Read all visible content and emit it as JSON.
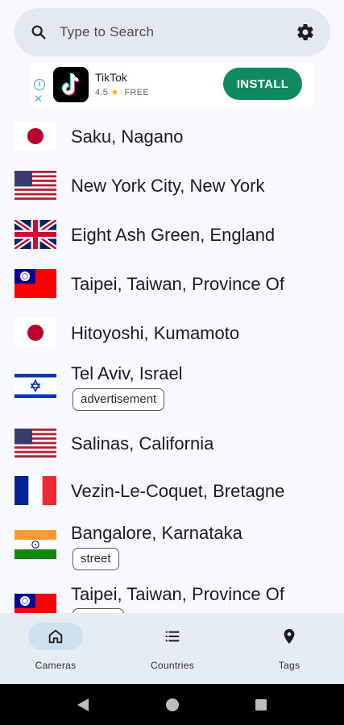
{
  "search": {
    "placeholder": "Type to Search",
    "icon": "search-icon",
    "settings_icon": "gear-icon"
  },
  "ad": {
    "info_icon": "i",
    "close_icon": "✕",
    "app_name": "TikTok",
    "rating": "4.5",
    "star": "★",
    "price": "FREE",
    "install_label": "INSTALL",
    "install_color": "#0f8a5f"
  },
  "cameras": [
    {
      "flag": "japan",
      "name": "Saku, Nagano"
    },
    {
      "flag": "usa",
      "name": "New York City, New York"
    },
    {
      "flag": "uk",
      "name": "Eight Ash Green, England"
    },
    {
      "flag": "taiwan",
      "name": "Taipei, Taiwan, Province Of"
    },
    {
      "flag": "japan",
      "name": "Hitoyoshi, Kumamoto"
    },
    {
      "flag": "israel",
      "name": "Tel Aviv, Israel",
      "tag": "advertisement"
    },
    {
      "flag": "usa",
      "name": "Salinas, California"
    },
    {
      "flag": "france",
      "name": "Vezin-Le-Coquet, Bretagne"
    },
    {
      "flag": "india",
      "name": "Bangalore, Karnataka",
      "tag": "street"
    },
    {
      "flag": "taiwan",
      "name": "Taipei, Taiwan, Province Of"
    }
  ],
  "nav": {
    "items": [
      {
        "label": "Cameras",
        "icon": "home-icon",
        "active": true
      },
      {
        "label": "Countries",
        "icon": "list-icon",
        "active": false
      },
      {
        "label": "Tags",
        "icon": "location-pin-icon",
        "active": false
      }
    ]
  },
  "system_nav": {
    "back": "back-icon",
    "home": "home-circle-icon",
    "recents": "recents-icon"
  }
}
